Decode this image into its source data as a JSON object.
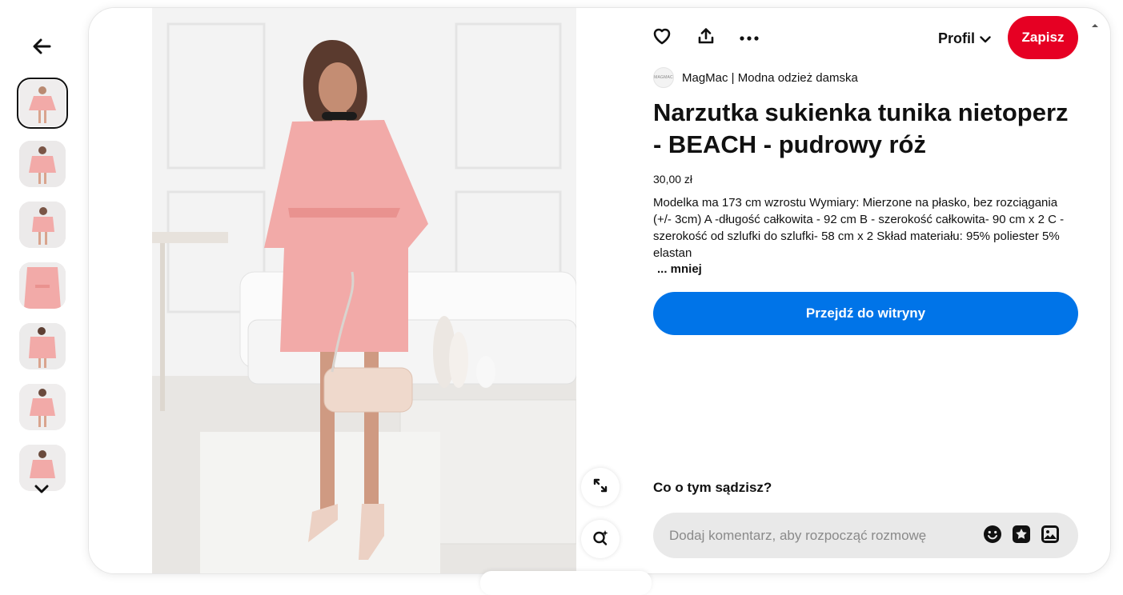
{
  "nav": {
    "back_icon": "arrow-left-icon"
  },
  "thumbnails": {
    "count": 7,
    "items": [
      "thumb-1",
      "thumb-2",
      "thumb-3",
      "thumb-4",
      "thumb-5",
      "thumb-6",
      "thumb-7"
    ],
    "more_icon": "chevron-down-icon"
  },
  "media": {
    "expand_icon": "expand-icon",
    "visual_search_icon": "visual-search-icon"
  },
  "toolbar": {
    "like_icon": "heart-icon",
    "share_icon": "share-icon",
    "more_icon": "ellipsis-icon",
    "profile_label": "Profil",
    "save_label": "Zapisz"
  },
  "pin": {
    "source_logo_text": "MAGMAC",
    "source_name": "MagMac | Modna odzież damska",
    "title": "Narzutka sukienka tunika nietoperz - BEACH - pudrowy róż",
    "price": "30,00 zł",
    "description": "Modelka ma 173 cm wzrostu Wymiary:  Mierzone na płasko, bez rozciągania (+/- 3cm) A  -długość całkowita - 92 cm B - szerokość całkowita- 90 cm x 2 C - szerokość od szlufki do szlufki- 58  cm x 2   Skład materiału: 95% poliester 5% elastan",
    "less_label": "... mniej",
    "visit_label": "Przejdź do witryny"
  },
  "comments": {
    "question": "Co o tym sądzisz?",
    "placeholder": "Dodaj komentarz, aby rozpocząć rozmowę",
    "emoji_icon": "emoji-icon",
    "sticker_icon": "sticker-icon",
    "image_icon": "image-icon"
  },
  "colors": {
    "save": "#e60023",
    "visit": "#0074e8",
    "dress": "#f2aaa8"
  }
}
